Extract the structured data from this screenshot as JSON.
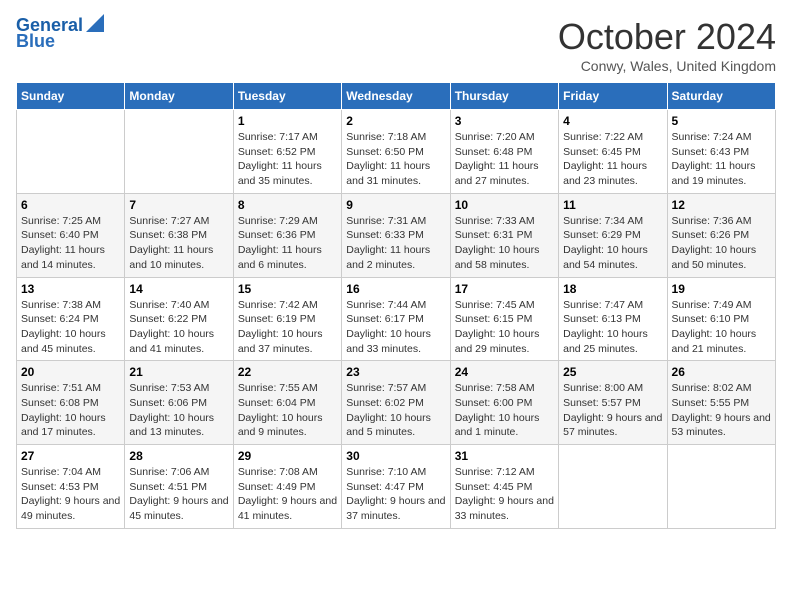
{
  "logo": {
    "line1": "General",
    "line2": "Blue"
  },
  "header": {
    "month": "October 2024",
    "location": "Conwy, Wales, United Kingdom"
  },
  "days_of_week": [
    "Sunday",
    "Monday",
    "Tuesday",
    "Wednesday",
    "Thursday",
    "Friday",
    "Saturday"
  ],
  "weeks": [
    [
      {
        "day": "",
        "info": ""
      },
      {
        "day": "",
        "info": ""
      },
      {
        "day": "1",
        "info": "Sunrise: 7:17 AM\nSunset: 6:52 PM\nDaylight: 11 hours and 35 minutes."
      },
      {
        "day": "2",
        "info": "Sunrise: 7:18 AM\nSunset: 6:50 PM\nDaylight: 11 hours and 31 minutes."
      },
      {
        "day": "3",
        "info": "Sunrise: 7:20 AM\nSunset: 6:48 PM\nDaylight: 11 hours and 27 minutes."
      },
      {
        "day": "4",
        "info": "Sunrise: 7:22 AM\nSunset: 6:45 PM\nDaylight: 11 hours and 23 minutes."
      },
      {
        "day": "5",
        "info": "Sunrise: 7:24 AM\nSunset: 6:43 PM\nDaylight: 11 hours and 19 minutes."
      }
    ],
    [
      {
        "day": "6",
        "info": "Sunrise: 7:25 AM\nSunset: 6:40 PM\nDaylight: 11 hours and 14 minutes."
      },
      {
        "day": "7",
        "info": "Sunrise: 7:27 AM\nSunset: 6:38 PM\nDaylight: 11 hours and 10 minutes."
      },
      {
        "day": "8",
        "info": "Sunrise: 7:29 AM\nSunset: 6:36 PM\nDaylight: 11 hours and 6 minutes."
      },
      {
        "day": "9",
        "info": "Sunrise: 7:31 AM\nSunset: 6:33 PM\nDaylight: 11 hours and 2 minutes."
      },
      {
        "day": "10",
        "info": "Sunrise: 7:33 AM\nSunset: 6:31 PM\nDaylight: 10 hours and 58 minutes."
      },
      {
        "day": "11",
        "info": "Sunrise: 7:34 AM\nSunset: 6:29 PM\nDaylight: 10 hours and 54 minutes."
      },
      {
        "day": "12",
        "info": "Sunrise: 7:36 AM\nSunset: 6:26 PM\nDaylight: 10 hours and 50 minutes."
      }
    ],
    [
      {
        "day": "13",
        "info": "Sunrise: 7:38 AM\nSunset: 6:24 PM\nDaylight: 10 hours and 45 minutes."
      },
      {
        "day": "14",
        "info": "Sunrise: 7:40 AM\nSunset: 6:22 PM\nDaylight: 10 hours and 41 minutes."
      },
      {
        "day": "15",
        "info": "Sunrise: 7:42 AM\nSunset: 6:19 PM\nDaylight: 10 hours and 37 minutes."
      },
      {
        "day": "16",
        "info": "Sunrise: 7:44 AM\nSunset: 6:17 PM\nDaylight: 10 hours and 33 minutes."
      },
      {
        "day": "17",
        "info": "Sunrise: 7:45 AM\nSunset: 6:15 PM\nDaylight: 10 hours and 29 minutes."
      },
      {
        "day": "18",
        "info": "Sunrise: 7:47 AM\nSunset: 6:13 PM\nDaylight: 10 hours and 25 minutes."
      },
      {
        "day": "19",
        "info": "Sunrise: 7:49 AM\nSunset: 6:10 PM\nDaylight: 10 hours and 21 minutes."
      }
    ],
    [
      {
        "day": "20",
        "info": "Sunrise: 7:51 AM\nSunset: 6:08 PM\nDaylight: 10 hours and 17 minutes."
      },
      {
        "day": "21",
        "info": "Sunrise: 7:53 AM\nSunset: 6:06 PM\nDaylight: 10 hours and 13 minutes."
      },
      {
        "day": "22",
        "info": "Sunrise: 7:55 AM\nSunset: 6:04 PM\nDaylight: 10 hours and 9 minutes."
      },
      {
        "day": "23",
        "info": "Sunrise: 7:57 AM\nSunset: 6:02 PM\nDaylight: 10 hours and 5 minutes."
      },
      {
        "day": "24",
        "info": "Sunrise: 7:58 AM\nSunset: 6:00 PM\nDaylight: 10 hours and 1 minute."
      },
      {
        "day": "25",
        "info": "Sunrise: 8:00 AM\nSunset: 5:57 PM\nDaylight: 9 hours and 57 minutes."
      },
      {
        "day": "26",
        "info": "Sunrise: 8:02 AM\nSunset: 5:55 PM\nDaylight: 9 hours and 53 minutes."
      }
    ],
    [
      {
        "day": "27",
        "info": "Sunrise: 7:04 AM\nSunset: 4:53 PM\nDaylight: 9 hours and 49 minutes."
      },
      {
        "day": "28",
        "info": "Sunrise: 7:06 AM\nSunset: 4:51 PM\nDaylight: 9 hours and 45 minutes."
      },
      {
        "day": "29",
        "info": "Sunrise: 7:08 AM\nSunset: 4:49 PM\nDaylight: 9 hours and 41 minutes."
      },
      {
        "day": "30",
        "info": "Sunrise: 7:10 AM\nSunset: 4:47 PM\nDaylight: 9 hours and 37 minutes."
      },
      {
        "day": "31",
        "info": "Sunrise: 7:12 AM\nSunset: 4:45 PM\nDaylight: 9 hours and 33 minutes."
      },
      {
        "day": "",
        "info": ""
      },
      {
        "day": "",
        "info": ""
      }
    ]
  ]
}
